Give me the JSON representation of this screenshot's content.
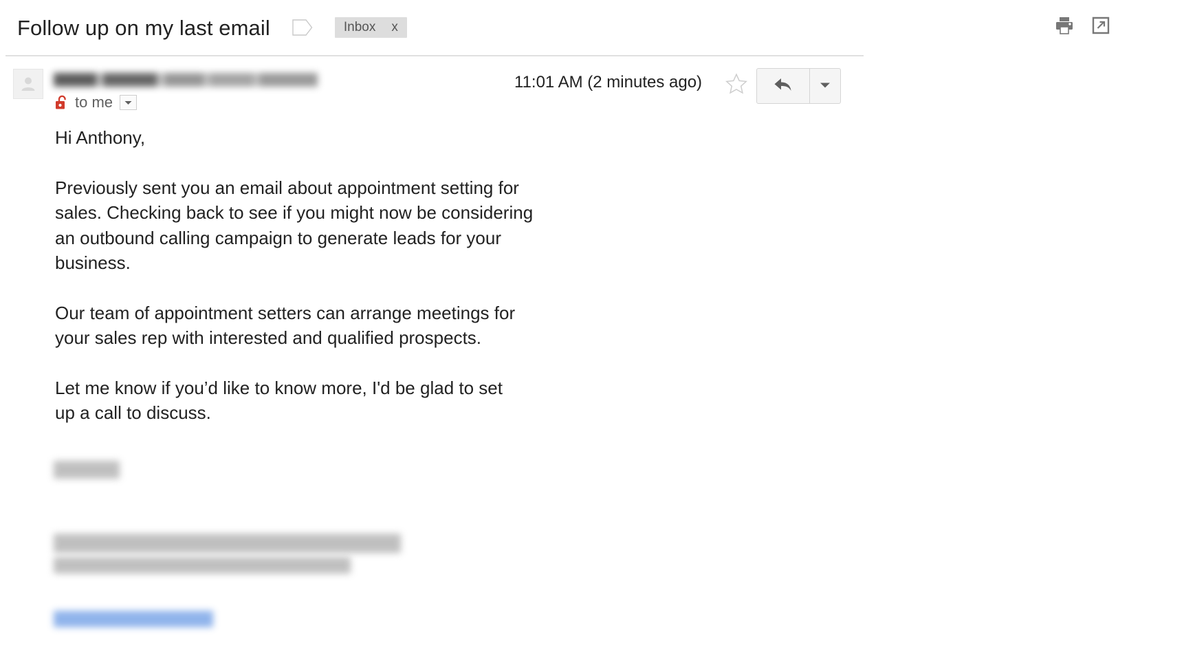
{
  "header": {
    "subject": "Follow up on my last email",
    "label_icon": "label-tag-icon",
    "labels": [
      {
        "name": "Inbox",
        "remove": "x"
      }
    ],
    "actions": [
      {
        "name": "print-icon",
        "title": "Print"
      },
      {
        "name": "open-in-new-window-icon",
        "title": "In new window"
      }
    ]
  },
  "message": {
    "avatar_icon": "person-placeholder-icon",
    "sender_name_redacted": "",
    "encryption_icon": "red-open-padlock-icon",
    "recipient": "to me",
    "recipient_caret_icon": "chevron-down-icon",
    "timestamp": "11:01 AM (2 minutes ago)",
    "star_icon": "star-outline-icon",
    "reply_icon": "reply-arrow-icon",
    "more_icon": "caret-down-icon",
    "body": {
      "greeting": "Hi Anthony,",
      "paragraph_1": "Previously sent you an email about appointment setting for\nsales. Checking back to see if you might now be considering\nan outbound calling campaign to generate leads for your\nbusiness.",
      "paragraph_2": "Our team of appointment setters can arrange meetings for\nyour sales rep with interested and qualified prospects.",
      "paragraph_3": "Let me know if you’d like to know more, I'd be glad to set\nup a call to discuss."
    },
    "signature_redacted": [
      "",
      "",
      ""
    ],
    "signature_link_redacted": ""
  },
  "colors": {
    "text": "#222222",
    "muted_text": "#5f5f5f",
    "chip_background": "#dddddd",
    "lock_red": "#d13b2c",
    "icon_gray": "#777777",
    "divider": "#e0e0e0",
    "link_blue": "#7da7e8"
  }
}
